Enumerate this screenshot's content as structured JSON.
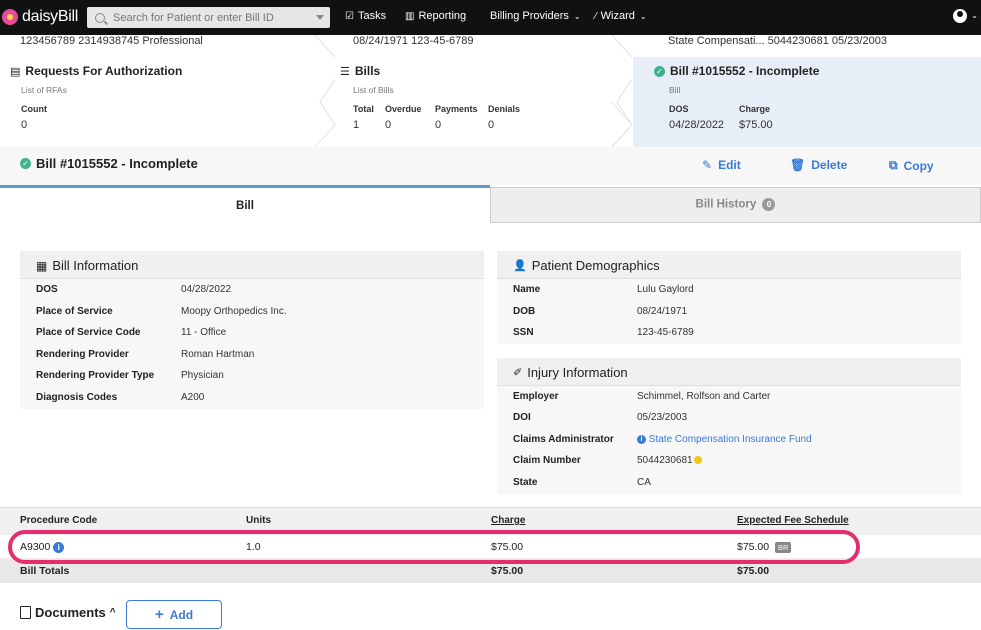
{
  "nav": {
    "logo": "daisyBill",
    "search_placeholder": "Search for Patient or enter Bill ID",
    "tasks": "Tasks",
    "reporting": "Reporting",
    "billing_providers": "Billing Providers",
    "wizard": "Wizard"
  },
  "crumbs": {
    "top_left": "123456789   2314938745   Professional",
    "top_mid": "08/24/1971   123-45-6789",
    "top_right": "State Compensati...   5044230681   05/23/2003",
    "rfa": {
      "title": "Requests For Authorization",
      "sub": "List of RFAs",
      "count_label": "Count",
      "count": "0"
    },
    "bills": {
      "title": "Bills",
      "sub": "List of Bills",
      "stats": [
        {
          "label": "Total",
          "value": "1"
        },
        {
          "label": "Overdue",
          "value": "0"
        },
        {
          "label": "Payments",
          "value": "0"
        },
        {
          "label": "Denials",
          "value": "0"
        }
      ]
    },
    "bill": {
      "title": "Bill #1015552 - Incomplete",
      "sub": "Bill",
      "dos_label": "DOS",
      "dos": "04/28/2022",
      "charge_label": "Charge",
      "charge": "$75.00"
    }
  },
  "header": {
    "title": "Bill #1015552 - Incomplete",
    "edit": "Edit",
    "delete": "Delete",
    "copy": "Copy"
  },
  "tabs": {
    "bill": "Bill",
    "history": "Bill History",
    "history_count": "0"
  },
  "bill_info": {
    "title": "Bill Information",
    "rows": [
      {
        "k": "DOS",
        "v": "04/28/2022"
      },
      {
        "k": "Place of Service",
        "v": "Moopy Orthopedics Inc."
      },
      {
        "k": "Place of Service Code",
        "v": "11 - Office"
      },
      {
        "k": "Rendering Provider",
        "v": "Roman Hartman"
      },
      {
        "k": "Rendering Provider Type",
        "v": "Physician"
      },
      {
        "k": "Diagnosis Codes",
        "v": "A200"
      }
    ]
  },
  "patient": {
    "title": "Patient Demographics",
    "rows": [
      {
        "k": "Name",
        "v": "Lulu Gaylord"
      },
      {
        "k": "DOB",
        "v": "08/24/1971"
      },
      {
        "k": "SSN",
        "v": "123-45-6789"
      }
    ]
  },
  "injury": {
    "title": "Injury Information",
    "rows": [
      {
        "k": "Employer",
        "v": "Schimmel, Rolfson and Carter"
      },
      {
        "k": "DOI",
        "v": "05/23/2003"
      },
      {
        "k": "Claims Administrator",
        "v": "State Compensation Insurance Fund"
      },
      {
        "k": "Claim Number",
        "v": "5044230681"
      },
      {
        "k": "State",
        "v": "CA"
      }
    ]
  },
  "procedures": {
    "headers": [
      "Procedure Code",
      "Units",
      "Charge",
      "Expected Fee Schedule"
    ],
    "row": {
      "code": "A9300",
      "units": "1.0",
      "charge": "$75.00",
      "expected": "$75.00",
      "badge": "BR"
    },
    "totals": {
      "label": "Bill Totals",
      "charge": "$75.00",
      "expected": "$75.00"
    }
  },
  "documents": {
    "title": "Documents",
    "add": "Add"
  },
  "colors": {
    "accent": "#3a7bd5",
    "highlight": "#e52c6d",
    "success": "#3fb28e"
  }
}
